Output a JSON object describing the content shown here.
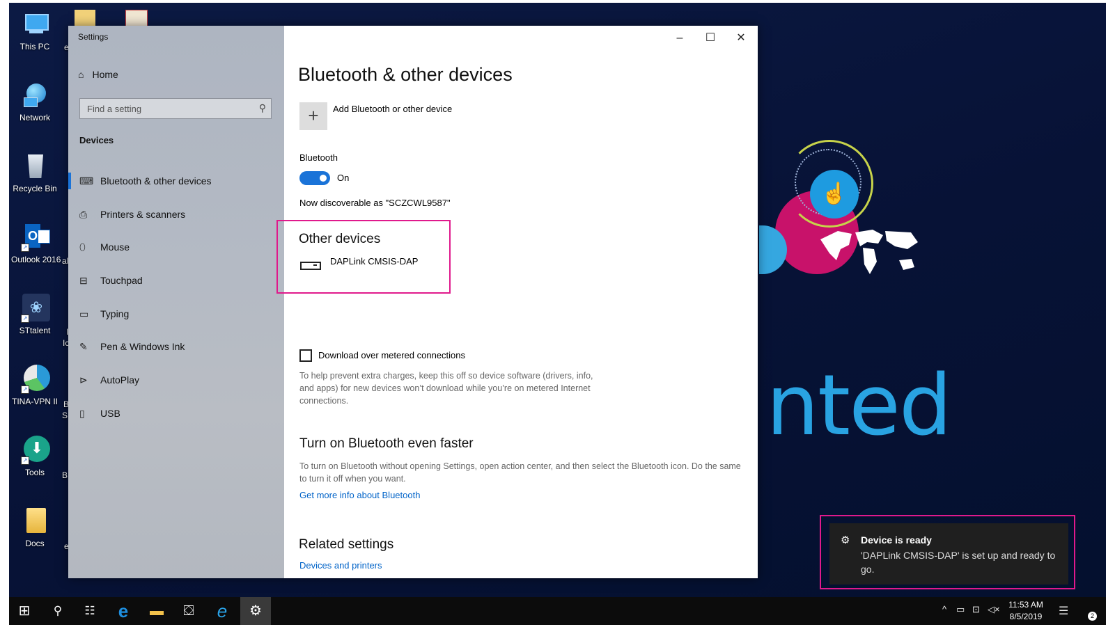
{
  "desktop": {
    "icons": [
      {
        "label": "This PC",
        "icon": "this-pc-icon"
      },
      {
        "label": "Network",
        "icon": "network-icon"
      },
      {
        "label": "Recycle Bin",
        "icon": "recycle-bin-icon"
      },
      {
        "label": "Outlook 2016",
        "icon": "outlook-icon"
      },
      {
        "label": "STtalent",
        "icon": "sttalent-icon"
      },
      {
        "label": "TINA-VPN II",
        "icon": "vpn-icon"
      },
      {
        "label": "Tools",
        "icon": "tools-icon"
      },
      {
        "label": "Docs",
        "icon": "docs-folder-icon"
      }
    ],
    "second_column_fragments": [
      "e",
      "al",
      "I",
      "Ic",
      "B",
      "S",
      "B",
      "e"
    ],
    "brand_word": "nted"
  },
  "settings": {
    "window_title": "Settings",
    "home_label": "Home",
    "search_placeholder": "Find a setting",
    "section_heading": "Devices",
    "nav_items": [
      {
        "label": "Bluetooth & other devices",
        "icon": "bluetooth-devices-icon",
        "active": true
      },
      {
        "label": "Printers & scanners",
        "icon": "printer-icon",
        "active": false
      },
      {
        "label": "Mouse",
        "icon": "mouse-icon",
        "active": false
      },
      {
        "label": "Touchpad",
        "icon": "touchpad-icon",
        "active": false
      },
      {
        "label": "Typing",
        "icon": "keyboard-icon",
        "active": false
      },
      {
        "label": "Pen & Windows Ink",
        "icon": "pen-icon",
        "active": false
      },
      {
        "label": "AutoPlay",
        "icon": "autoplay-icon",
        "active": false
      },
      {
        "label": "USB",
        "icon": "usb-icon",
        "active": false
      }
    ],
    "window_controls": {
      "minimize": "–",
      "maximize": "☐",
      "close": "✕"
    },
    "main": {
      "page_title": "Bluetooth & other devices",
      "add_device_label": "Add Bluetooth or other device",
      "bluetooth_label": "Bluetooth",
      "bluetooth_state": "On",
      "bluetooth_on": true,
      "discoverable_text": "Now discoverable as \"SCZCWL9587\"",
      "other_devices_heading": "Other devices",
      "other_devices": [
        {
          "name": "DAPLink CMSIS-DAP",
          "icon": "drive-icon"
        }
      ],
      "metered_label": "Download over metered connections",
      "metered_checked": false,
      "metered_help": "To help prevent extra charges, keep this off so device software (drivers, info, and apps) for new devices won’t download while you’re on metered Internet connections.",
      "faster_heading": "Turn on Bluetooth even faster",
      "faster_help": "To turn on Bluetooth without opening Settings, open action center, and then select the Bluetooth icon. Do the same to turn it off when you want.",
      "bluetooth_info_link": "Get more info about Bluetooth",
      "related_heading": "Related settings",
      "devices_printers_link": "Devices and printers"
    }
  },
  "toast": {
    "title": "Device is ready",
    "message": "'DAPLink CMSIS-DAP' is set up and ready to go."
  },
  "taskbar": {
    "buttons": [
      "start-icon",
      "search-icon",
      "task-view-icon",
      "edge-icon",
      "file-explorer-icon",
      "store-icon",
      "internet-explorer-icon",
      "settings-gear-icon"
    ],
    "time": "11:53 AM",
    "date": "8/5/2019",
    "notification_count": "2"
  },
  "colors": {
    "accent": "#1a73d8",
    "highlight_frame": "#e0198c",
    "link": "#0063c8",
    "desktop_bg": "#071236"
  }
}
